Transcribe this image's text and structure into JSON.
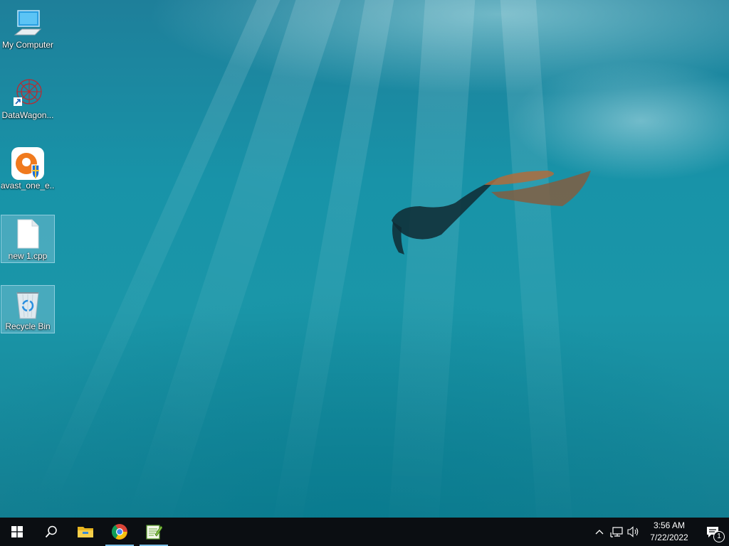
{
  "desktop": {
    "icons": [
      {
        "label": "My Computer",
        "icon": "computer-icon"
      },
      {
        "label": "DataWagon...",
        "icon": "datawagon-icon"
      },
      {
        "label": "avast_one_e...",
        "icon": "avast-icon"
      },
      {
        "label": "new 1.cpp",
        "icon": "document-icon"
      },
      {
        "label": "Recycle Bin",
        "icon": "recycle-bin-icon"
      }
    ]
  },
  "taskbar": {
    "apps": [
      {
        "icon": "start-icon"
      },
      {
        "icon": "search-icon"
      },
      {
        "icon": "file-explorer-icon"
      },
      {
        "icon": "chrome-icon"
      },
      {
        "icon": "notepad-plus-icon"
      }
    ],
    "tray": {
      "time": "3:56 AM",
      "date": "7/22/2022",
      "notification_count": "1"
    }
  },
  "colors": {
    "taskbar": "#0b0e12",
    "active_indicator": "#7cc0e8",
    "avast_orange": "#f07a1e"
  }
}
